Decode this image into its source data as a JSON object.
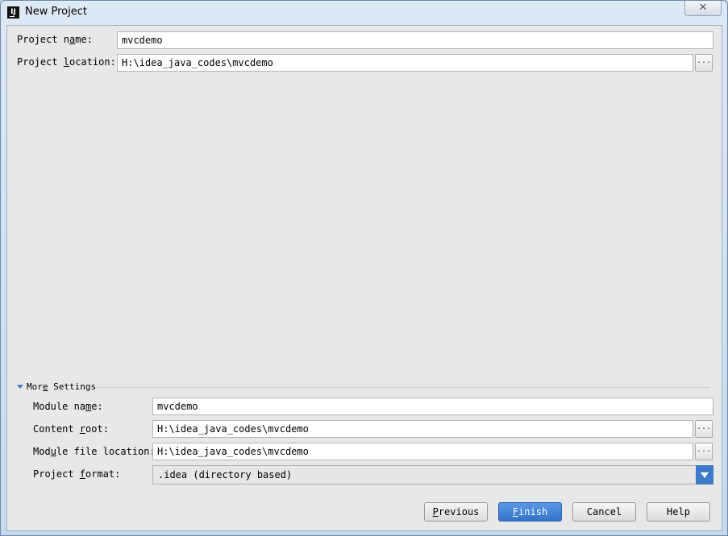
{
  "window": {
    "title": "New Project",
    "icon_letters": "IJ",
    "close_symbol": "✕"
  },
  "main": {
    "project_name": {
      "label_pre": "Project n",
      "label_mn": "a",
      "label_post": "me:",
      "value": "mvcdemo"
    },
    "project_location": {
      "label_pre": "Project ",
      "label_mn": "l",
      "label_post": "ocation:",
      "value": "H:\\idea_java_codes\\mvcdemo",
      "browse": "..."
    }
  },
  "more_settings": {
    "title_pre": "Mor",
    "title_mn": "e",
    "title_post": " Settings",
    "module_name": {
      "label_pre": "Module na",
      "label_mn": "m",
      "label_post": "e:",
      "value": "mvcdemo"
    },
    "content_root": {
      "label_pre": "Content ",
      "label_mn": "r",
      "label_post": "oot:",
      "value": "H:\\idea_java_codes\\mvcdemo",
      "browse": "..."
    },
    "module_file_location": {
      "label_pre": "Mod",
      "label_mn": "u",
      "label_post": "le file location:",
      "value": "H:\\idea_java_codes\\mvcdemo",
      "browse": "..."
    },
    "project_format": {
      "label_pre": "Project ",
      "label_mn": "f",
      "label_post": "ormat:",
      "value": ".idea (directory based)"
    }
  },
  "buttons": {
    "previous": {
      "pre": "",
      "mn": "P",
      "post": "revious"
    },
    "finish": {
      "pre": "",
      "mn": "F",
      "post": "inish"
    },
    "cancel": "Cancel",
    "help": "Help"
  },
  "colors": {
    "accent": "#3d7bc8",
    "dialog_bg": "#e8e8e8"
  }
}
